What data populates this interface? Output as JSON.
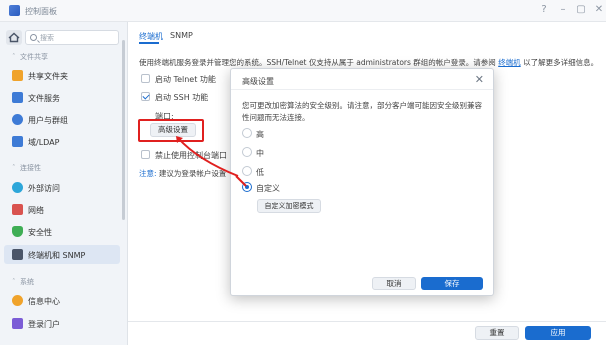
{
  "window": {
    "title": "控制面板"
  },
  "sidebar": {
    "search_placeholder": "搜索",
    "sections": [
      {
        "label": "文件共享",
        "items": [
          {
            "label": "共享文件夹",
            "icon": "folder-share-icon",
            "color": "#f0a32b"
          },
          {
            "label": "文件服务",
            "icon": "file-service-icon",
            "color": "#3e7bd6"
          },
          {
            "label": "用户与群组",
            "icon": "users-icon",
            "color": "#3e7bd6"
          },
          {
            "label": "域/LDAP",
            "icon": "domain-icon",
            "color": "#3e7bd6"
          }
        ]
      },
      {
        "label": "连接性",
        "items": [
          {
            "label": "外部访问",
            "icon": "globe-icon",
            "color": "#2da6d9"
          },
          {
            "label": "网络",
            "icon": "network-icon",
            "color": "#d9534f"
          },
          {
            "label": "安全性",
            "icon": "shield-icon",
            "color": "#3fae55"
          },
          {
            "label": "终端机和 SNMP",
            "icon": "terminal-icon",
            "color": "#4a5568"
          }
        ]
      },
      {
        "label": "系统",
        "items": [
          {
            "label": "信息中心",
            "icon": "info-icon",
            "color": "#f0a32b"
          },
          {
            "label": "登录门户",
            "icon": "login-portal-icon",
            "color": "#7b5cd6"
          }
        ]
      }
    ]
  },
  "tabs": [
    {
      "label": "终端机"
    },
    {
      "label": "SNMP"
    }
  ],
  "main": {
    "desc_pre": "使用终端机服务登录并管理您的系统。SSH/Telnet 仅支持从属于 administrators 群组的帐户登录。请参阅",
    "desc_link": "终端机",
    "desc_post": "以了解更多详细信息。",
    "telnet_label": "启动 Telnet 功能",
    "ssh_label": "启动 SSH 功能",
    "port_label": "端口:",
    "advanced_button": "高级设置",
    "console_label": "禁止使用控制台端口",
    "note_prefix": "注意:",
    "note_text": "建议为登录帐户设置",
    "reset_button": "重置",
    "apply_button": "应用"
  },
  "dialog": {
    "title": "高级设置",
    "description": "您可更改加密算法的安全级别。请注意，部分客户端可能因安全级别兼容性问题而无法连接。",
    "options": [
      {
        "label": "高",
        "selected": false
      },
      {
        "label": "中",
        "selected": false
      },
      {
        "label": "低",
        "selected": false
      },
      {
        "label": "自定义",
        "selected": true
      }
    ],
    "custom_button": "自定义加密模式",
    "cancel_button": "取消",
    "save_button": "保存"
  },
  "colors": {
    "accent": "#1a6ccf",
    "highlight": "#e0201f"
  }
}
